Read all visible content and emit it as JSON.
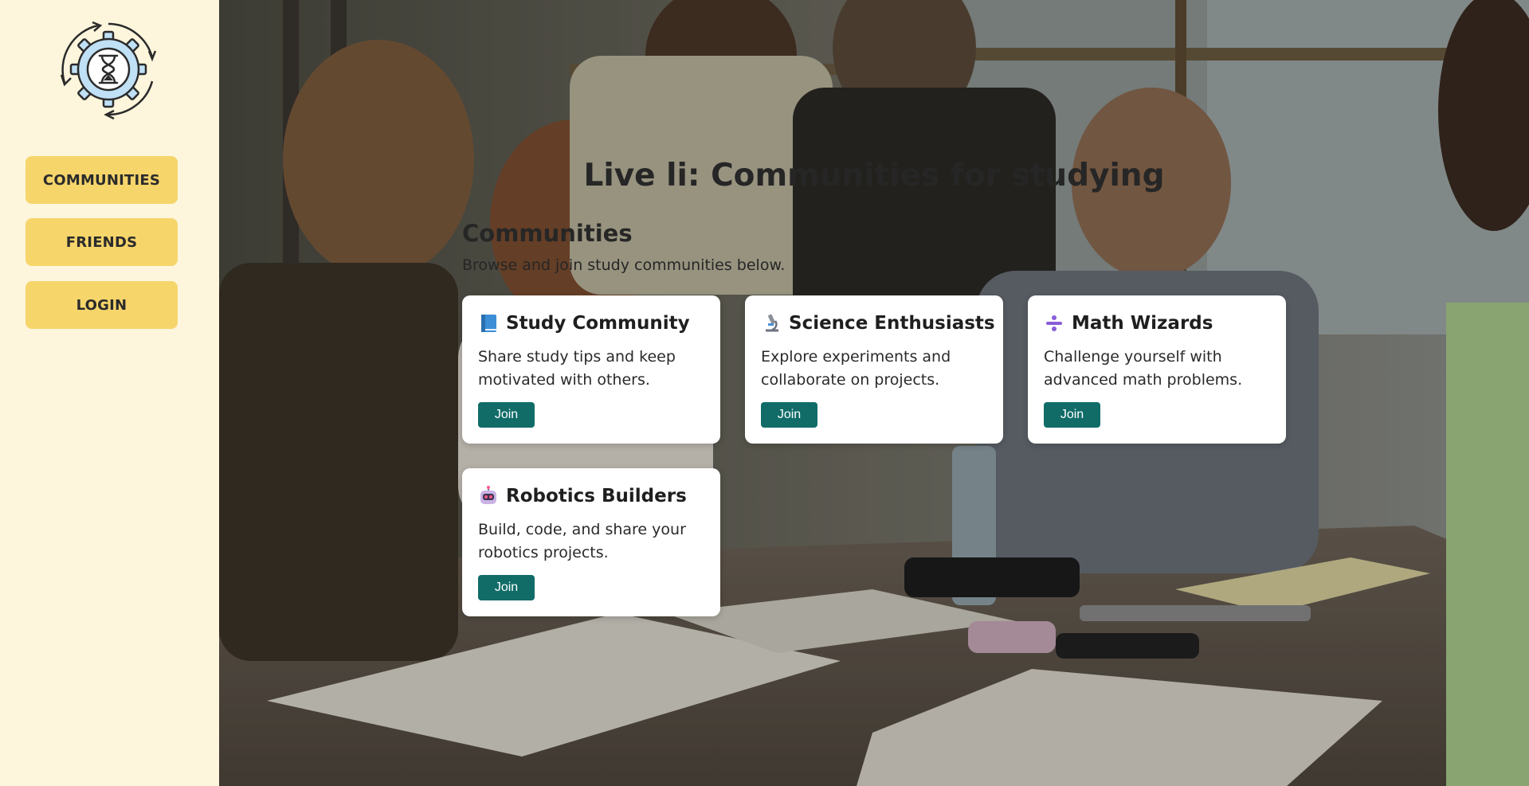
{
  "sidebar": {
    "nav": [
      "COMMUNITIES",
      "FRIENDS",
      "LOGIN"
    ]
  },
  "main": {
    "title": "Live li: Communities for studying",
    "section_title": "Communities",
    "section_subtitle": "Browse and join study communities below.",
    "cards": [
      {
        "icon": "blue-book-icon",
        "title": "Study Community",
        "description": "Share study tips and keep motivated with others.",
        "button": "Join"
      },
      {
        "icon": "microscope-icon",
        "title": "Science Enthusiasts",
        "description": "Explore experiments and collaborate on projects.",
        "button": "Join"
      },
      {
        "icon": "division-sign-icon",
        "title": "Math Wizards",
        "description": "Challenge yourself with advanced math problems.",
        "button": "Join"
      },
      {
        "icon": "robot-icon",
        "title": "Robotics Builders",
        "description": "Build, code, and share your robotics projects.",
        "button": "Join"
      }
    ]
  },
  "colors": {
    "sidebar_bg": "#fdf6dc",
    "nav_button": "#f6d56b",
    "join_button": "#116c68",
    "card_bg": "#ffffff"
  }
}
